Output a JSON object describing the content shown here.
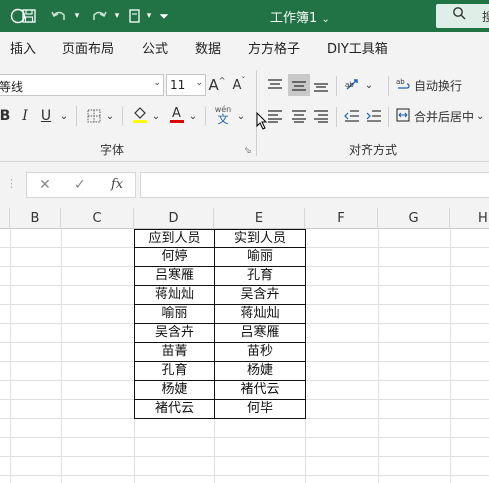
{
  "titlebar": {
    "doc_title": "工作簿1",
    "title_chevron": "⌄",
    "qat": {
      "save_icon": "save-icon",
      "undo_icon": "undo-icon",
      "redo_icon": "redo-icon",
      "format_painter_icon": "format-painter-icon",
      "customize_icon": "customize-qat-icon"
    },
    "search_partial": "搜"
  },
  "tabs": [
    "插入",
    "页面布局",
    "公式",
    "数据",
    "方方格子",
    "DIY工具箱"
  ],
  "font_group": {
    "font_name": "等线",
    "font_size": "11",
    "grow_label": "A",
    "shrink_label": "A",
    "bold_label": "B",
    "italic_label": "I",
    "underline_label": "U",
    "phonetic_label": "wén",
    "group_label": "字体"
  },
  "align_group": {
    "wrap_label": "自动换行",
    "merge_label": "合并后居中",
    "group_label": "对齐方式"
  },
  "formula_bar": {
    "cancel": "✕",
    "enter": "✓",
    "fx": "fx",
    "value": ""
  },
  "grid": {
    "columns": [
      "B",
      "C",
      "D",
      "E",
      "F",
      "G",
      "H"
    ],
    "headers": [
      "应到人员",
      "实到人员"
    ],
    "rows": [
      [
        "何婷",
        "喻丽"
      ],
      [
        "吕寒雁",
        "孔育"
      ],
      [
        "蒋灿灿",
        "吴含卉"
      ],
      [
        "喻丽",
        "蒋灿灿"
      ],
      [
        "吴含卉",
        "吕寒雁"
      ],
      [
        "苗菁",
        "苗秒"
      ],
      [
        "孔育",
        "杨婕"
      ],
      [
        "杨婕",
        "褚代云"
      ],
      [
        "褚代云",
        "何毕"
      ]
    ]
  },
  "colors": {
    "title_green": "#217346",
    "ribbon_bg": "#f3f3f3",
    "highlight_yellow": "#ffff00",
    "font_red": "#e00000"
  }
}
